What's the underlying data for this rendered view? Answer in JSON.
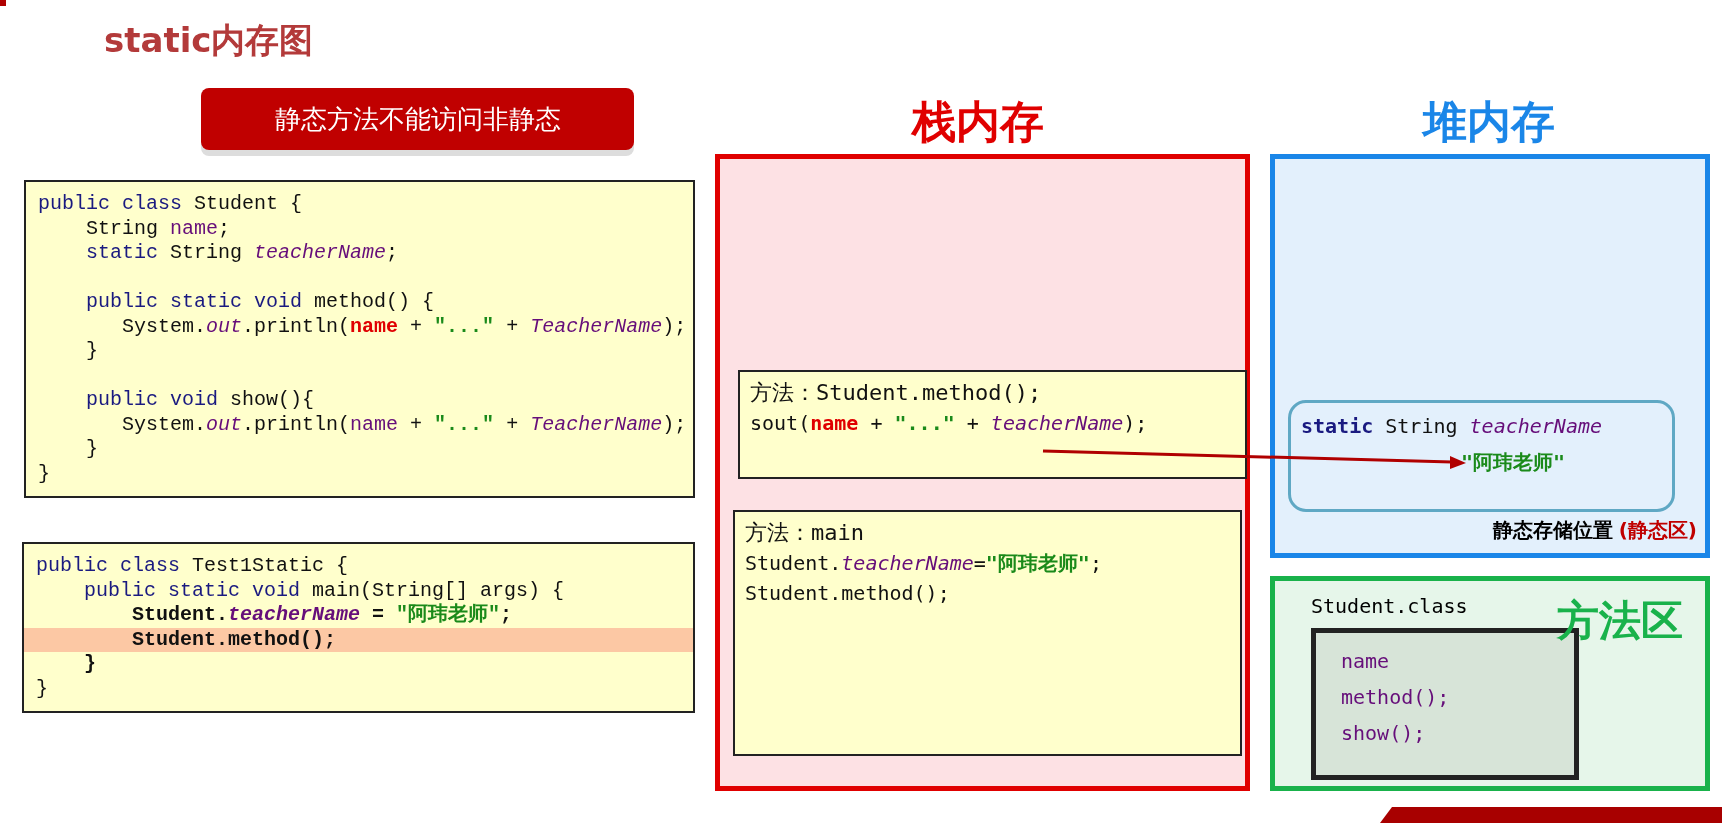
{
  "title": "static内存图",
  "banner": "静态方法不能访问非静态",
  "code_blocks": [
    {
      "lines": [
        {
          "tokens": [
            {
              "text": "public class",
              "kind": "kw"
            },
            {
              "text": " Student {",
              "kind": "plain"
            }
          ]
        },
        {
          "tokens": [
            {
              "text": "    String ",
              "kind": "plain"
            },
            {
              "text": "name",
              "kind": "field"
            },
            {
              "text": ";",
              "kind": "plain"
            }
          ]
        },
        {
          "tokens": [
            {
              "text": "    static",
              "kind": "kw"
            },
            {
              "text": " String ",
              "kind": "plain"
            },
            {
              "text": "teacherName",
              "kind": "fielditalic"
            },
            {
              "text": ";",
              "kind": "plain"
            }
          ]
        },
        {
          "gap_before": true,
          "tokens": [
            {
              "text": "    public static void",
              "kind": "kw"
            },
            {
              "text": " method() {",
              "kind": "plain"
            }
          ]
        },
        {
          "tokens": [
            {
              "text": "       System.",
              "kind": "plain"
            },
            {
              "text": "out",
              "kind": "fielditalic"
            },
            {
              "text": ".println(",
              "kind": "plain"
            },
            {
              "text": "name",
              "kind": "error"
            },
            {
              "text": " + ",
              "kind": "plain"
            },
            {
              "text": "\"...\"",
              "kind": "string"
            },
            {
              "text": " + ",
              "kind": "plain"
            },
            {
              "text": "TeacherName",
              "kind": "fielditalic"
            },
            {
              "text": ");",
              "kind": "plain"
            }
          ]
        },
        {
          "tokens": [
            {
              "text": "    }",
              "kind": "plain"
            }
          ]
        },
        {
          "gap_before": true,
          "tokens": [
            {
              "text": "    public void",
              "kind": "kw"
            },
            {
              "text": " show(){",
              "kind": "plain"
            }
          ]
        },
        {
          "tokens": [
            {
              "text": "       System.",
              "kind": "plain"
            },
            {
              "text": "out",
              "kind": "fielditalic"
            },
            {
              "text": ".println(",
              "kind": "plain"
            },
            {
              "text": "name",
              "kind": "field"
            },
            {
              "text": " + ",
              "kind": "plain"
            },
            {
              "text": "\"...\"",
              "kind": "string"
            },
            {
              "text": " + ",
              "kind": "plain"
            },
            {
              "text": "TeacherName",
              "kind": "fielditalic"
            },
            {
              "text": ");",
              "kind": "plain"
            }
          ]
        },
        {
          "tokens": [
            {
              "text": "    }",
              "kind": "plain"
            }
          ]
        },
        {
          "tokens": [
            {
              "text": "}",
              "kind": "plain"
            }
          ]
        }
      ]
    },
    {
      "lines": [
        {
          "tokens": [
            {
              "text": "public class",
              "kind": "kw"
            },
            {
              "text": " Test1Static {",
              "kind": "plain"
            }
          ]
        },
        {
          "tokens": [
            {
              "text": "    public static void",
              "kind": "kw"
            },
            {
              "text": " main(String[] args) {",
              "kind": "plain"
            }
          ]
        },
        {
          "tokens": [
            {
              "text": "        Student.",
              "kind": "bold"
            },
            {
              "text": "teacherName",
              "kind": "boldfield"
            },
            {
              "text": " = ",
              "kind": "bold"
            },
            {
              "text": "\"阿玮老师\"",
              "kind": "string"
            },
            {
              "text": ";",
              "kind": "bold"
            }
          ]
        },
        {
          "highlighted": true,
          "tokens": [
            {
              "text": "        Student.method();",
              "kind": "bold"
            }
          ]
        },
        {
          "tokens": [
            {
              "text": "    }",
              "kind": "bold"
            }
          ]
        },
        {
          "tokens": [
            {
              "text": "}",
              "kind": "plain"
            }
          ]
        }
      ]
    }
  ],
  "stack": {
    "heading": "栈内存",
    "frames": [
      {
        "lines": [
          {
            "tokens": [
              {
                "text": "方法：Student.method();",
                "kind": "plain"
              }
            ]
          },
          {
            "tokens": [
              {
                "text": "sout(",
                "kind": "plain"
              },
              {
                "text": "name",
                "kind": "error"
              },
              {
                "text": " + ",
                "kind": "plain"
              },
              {
                "text": "\"...\"",
                "kind": "string"
              },
              {
                "text": " + ",
                "kind": "plain"
              },
              {
                "text": "teacherName",
                "kind": "fielditalic"
              },
              {
                "text": ");",
                "kind": "plain"
              }
            ]
          }
        ]
      },
      {
        "lines": [
          {
            "tokens": [
              {
                "text": "方法：main",
                "kind": "plain"
              }
            ]
          },
          {
            "tokens": [
              {
                "text": "Student.",
                "kind": "plain"
              },
              {
                "text": "teacherName",
                "kind": "fielditalic"
              },
              {
                "text": "=",
                "kind": "plain"
              },
              {
                "text": "\"阿玮老师\"",
                "kind": "string"
              },
              {
                "text": ";",
                "kind": "plain"
              }
            ]
          },
          {
            "tokens": [
              {
                "text": "Student.method();",
                "kind": "plain"
              }
            ]
          }
        ]
      }
    ]
  },
  "heap": {
    "heading": "堆内存",
    "static_area": {
      "declaration": [
        {
          "text": "static",
          "kind": "boldkw"
        },
        {
          "text": " String ",
          "kind": "plain"
        },
        {
          "text": "teacherName",
          "kind": "fielditalic"
        }
      ],
      "value": "\"阿玮老师\"",
      "label": "静态存储位置",
      "label_note": "(静态区)"
    }
  },
  "method_area": {
    "heading": "方法区",
    "class_name": "Student.class",
    "members": [
      "name",
      "method();",
      "show();"
    ]
  }
}
